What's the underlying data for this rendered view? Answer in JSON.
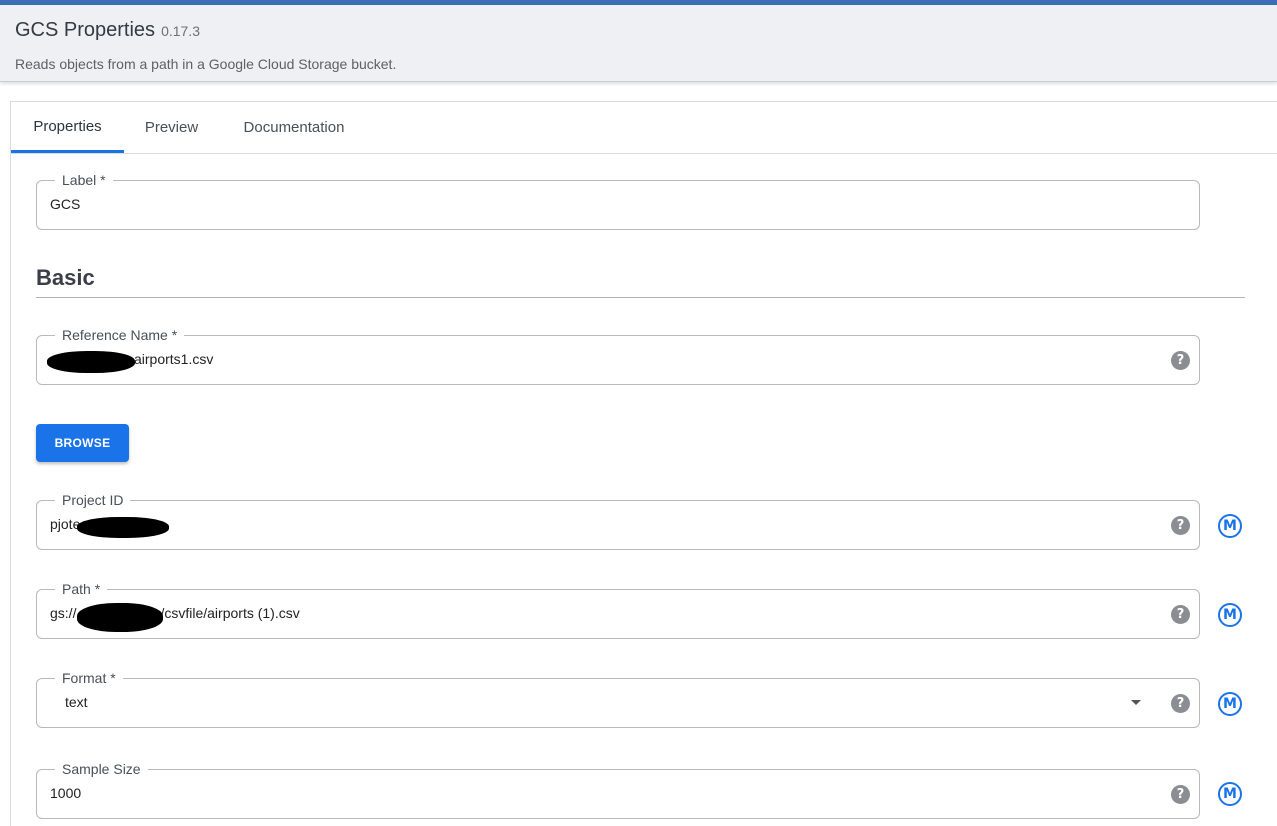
{
  "header": {
    "title": "GCS Properties",
    "version": "0.17.3",
    "description": "Reads objects from a path in a Google Cloud Storage bucket."
  },
  "tabs": [
    {
      "label": "Properties",
      "active": true
    },
    {
      "label": "Preview",
      "active": false
    },
    {
      "label": "Documentation",
      "active": false
    }
  ],
  "fields": {
    "label": {
      "legend": "Label",
      "required_mark": "*",
      "value": "GCS"
    },
    "reference_name": {
      "legend": "Reference Name",
      "required_mark": "*",
      "value": "airports1.csv"
    },
    "project_id": {
      "legend": "Project ID",
      "value": "pjote"
    },
    "path": {
      "legend": "Path",
      "required_mark": "*",
      "value_prefix": "gs://",
      "value_suffix": "/csvfile/airports (1).csv"
    },
    "format": {
      "legend": "Format",
      "required_mark": "*",
      "value": "text"
    },
    "sample_size": {
      "legend": "Sample Size",
      "value": "1000"
    }
  },
  "section": {
    "title": "Basic"
  },
  "browse_button": {
    "label": "BROWSE"
  },
  "icons": {
    "help": "?",
    "macro": "M"
  },
  "colors": {
    "accent": "#1a73e8",
    "topbar": "#3a6fb7",
    "help_icon": "#8a8d91"
  }
}
